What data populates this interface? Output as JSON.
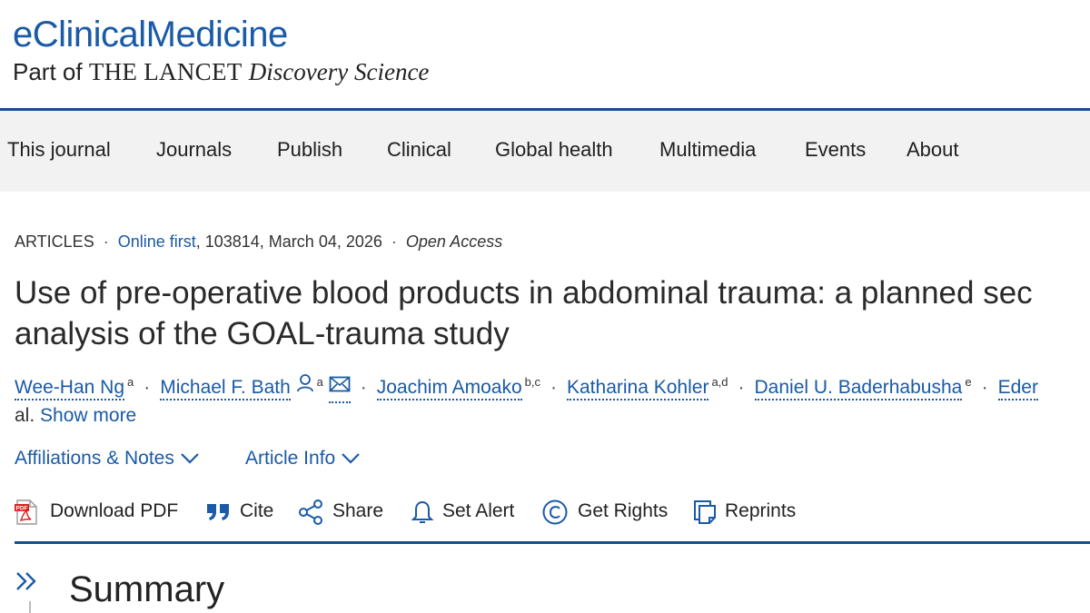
{
  "header": {
    "journal_title": "eClinicalMedicine",
    "sub_prefix": "Part of ",
    "sub_lancet": "THE LANCET",
    "sub_discovery": "Discovery Science"
  },
  "nav": {
    "items": [
      "This journal",
      "Journals",
      "Publish",
      "Clinical",
      "Global health",
      "Multimedia",
      "Events",
      "About"
    ]
  },
  "article": {
    "section": "ARTICLES",
    "online_first": "Online first",
    "meta_rest": ", 103814, March 04, 2026",
    "open_access": "Open Access",
    "title_line1": "Use of pre-operative blood products in abdominal trauma: a planned sec",
    "title_line2": "analysis of the GOAL-trauma study",
    "authors": [
      {
        "name": "Wee-Han Ng",
        "sup": "a"
      },
      {
        "name": "Michael F. Bath",
        "sup": "a"
      },
      {
        "name": "Joachim Amoako",
        "sup": "b,c"
      },
      {
        "name": "Katharina Kohler",
        "sup": "a,d"
      },
      {
        "name": "Daniel U. Baderhabusha",
        "sup": "e"
      },
      {
        "name": "Eder",
        "sup": ""
      }
    ],
    "authors_tail": "al.",
    "show_more": "Show more",
    "affiliations_label": "Affiliations & Notes",
    "article_info_label": "Article Info"
  },
  "toolbar": {
    "download_pdf": "Download PDF",
    "pdf_icon_text": "PDF",
    "cite": "Cite",
    "share": "Share",
    "set_alert": "Set Alert",
    "get_rights": "Get Rights",
    "reprints": "Reprints"
  },
  "summary": {
    "heading": "Summary"
  },
  "colors": {
    "brand_blue": "#1a5aa6",
    "rule_blue": "#16508c",
    "nav_bg": "#f2f2f2",
    "pdf_red": "#d9231f"
  },
  "icons": [
    "person-icon",
    "mail-icon",
    "chevron-down-icon",
    "pdf-icon",
    "quote-icon",
    "share-icon",
    "bell-icon",
    "copyright-icon",
    "reprints-icon",
    "double-chevron-right-icon"
  ]
}
